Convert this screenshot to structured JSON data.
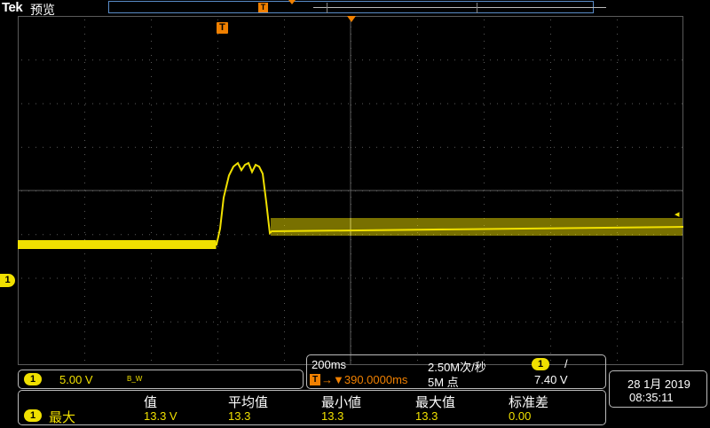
{
  "header": {
    "brand": "Tek",
    "mode": "预览",
    "trigger_marker": "T"
  },
  "channel": {
    "number": "1",
    "scale": "5.00 V",
    "bw_label": "B_W"
  },
  "timebase": {
    "scale": "200ms",
    "sample_rate": "2.50M次/秒",
    "trigger_symbol": "T",
    "position": "→▼390.0000ms",
    "record_length": "5M 点"
  },
  "trigger": {
    "source": "1",
    "slope": "/",
    "level": "7.40 V"
  },
  "datetime": {
    "date": "28 1月 2019",
    "time": "08:35:11"
  },
  "measurement": {
    "headers": [
      "值",
      "平均值",
      "最小値",
      "最大值",
      "标准差"
    ],
    "source": "1",
    "name": "最大",
    "values": [
      "13.3 V",
      "13.3",
      "13.3",
      "13.3",
      "0.00"
    ]
  },
  "colors": {
    "trace": "#f0e000",
    "trigger": "#f08000",
    "grid": "#5a5a5a"
  }
}
